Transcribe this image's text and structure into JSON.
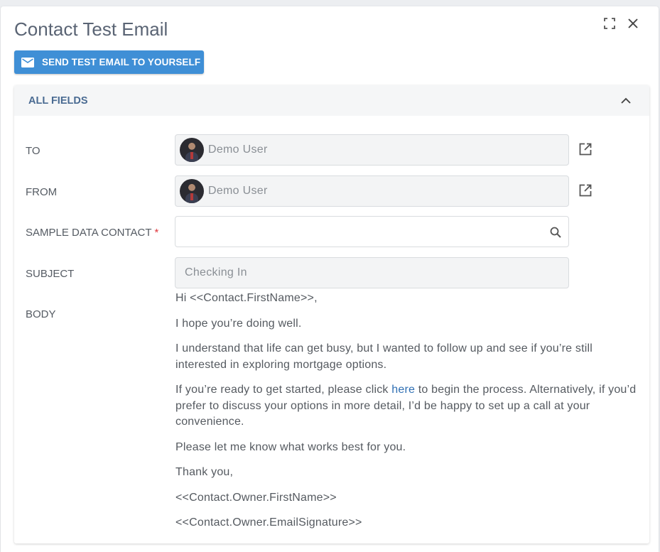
{
  "dialog": {
    "title": "Contact Test Email",
    "send_button_label": "SEND TEST EMAIL TO YOURSELF"
  },
  "panel": {
    "title": "ALL FIELDS"
  },
  "fields": {
    "to": {
      "label": "TO",
      "value": "Demo User"
    },
    "from": {
      "label": "FROM",
      "value": "Demo User"
    },
    "sample_contact": {
      "label": "SAMPLE DATA CONTACT",
      "required_mark": "*",
      "value": ""
    },
    "subject": {
      "label": "SUBJECT",
      "value": "Checking In"
    },
    "body": {
      "label": "BODY",
      "greeting": "Hi <<Contact.FirstName>>,",
      "p1": "I hope you’re doing well.",
      "p2": "I understand that life can get busy, but I wanted to follow up and see if you’re still interested in exploring mortgage options.",
      "p3_before": "If you’re ready to get started, please click ",
      "p3_link": "here",
      "p3_after": " to begin the process. Alternatively, if you’d prefer to discuss your options in more detail, I’d be happy to set up a call at your convenience.",
      "p4": "Please let me know what works best for you.",
      "p5": "Thank you,",
      "p6": "<<Contact.Owner.FirstName>>",
      "p7": "<<Contact.Owner.EmailSignature>>"
    }
  },
  "icons": {
    "expand": "fullscreen-icon",
    "close": "close-icon",
    "mail": "mail-icon",
    "collapse": "chevron-up-icon",
    "external": "open-in-new-icon",
    "search": "search-icon"
  },
  "colors": {
    "accent": "#3f8fd6",
    "link": "#2f6fb3",
    "panel_title": "#4a6b92",
    "required": "#e0383e"
  }
}
